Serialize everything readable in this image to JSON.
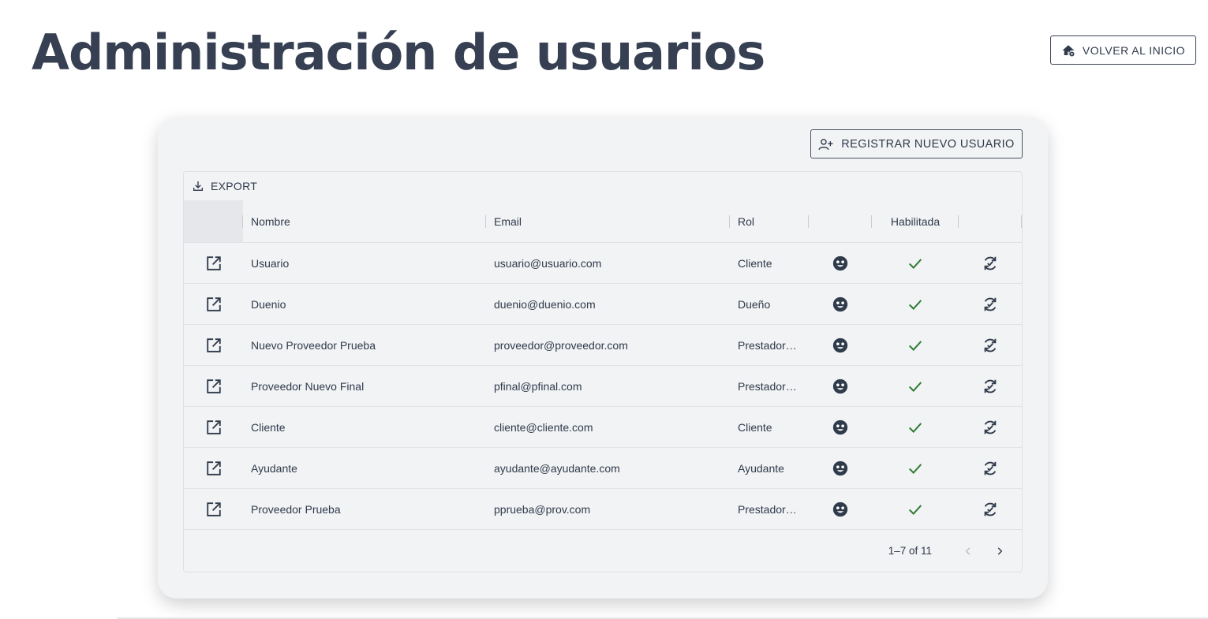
{
  "page": {
    "title": "Administración de usuarios",
    "home_button": "VOLVER AL INICIO"
  },
  "toolbar": {
    "register_button": "REGISTRAR NUEVO USUARIO",
    "export_button": "EXPORT"
  },
  "table": {
    "columns": [
      "Nombre",
      "Email",
      "Rol",
      "",
      "Habilitada",
      ""
    ],
    "rows": [
      {
        "nombre": "Usuario",
        "email": "usuario@usuario.com",
        "rol": "Cliente",
        "habilitada": true
      },
      {
        "nombre": "Duenio",
        "email": "duenio@duenio.com",
        "rol": "Dueño",
        "habilitada": true
      },
      {
        "nombre": "Nuevo Proveedor Prueba",
        "email": "proveedor@proveedor.com",
        "rol": "Prestador…",
        "habilitada": true
      },
      {
        "nombre": "Proveedor Nuevo Final",
        "email": "pfinal@pfinal.com",
        "rol": "Prestador…",
        "habilitada": true
      },
      {
        "nombre": "Cliente",
        "email": "cliente@cliente.com",
        "rol": "Cliente",
        "habilitada": true
      },
      {
        "nombre": "Ayudante",
        "email": "ayudante@ayudante.com",
        "rol": "Ayudante",
        "habilitada": true
      },
      {
        "nombre": "Proveedor Prueba",
        "email": "pprueba@prov.com",
        "rol": "Prestador…",
        "habilitada": true
      }
    ]
  },
  "pagination": {
    "label": "1–7 of 11",
    "prev_enabled": false,
    "next_enabled": true
  },
  "colors": {
    "title": "#364052",
    "check": "#2e7d32",
    "icon": "#2f3a4b",
    "disabled": "#b9bdc4"
  },
  "icons": {
    "home": "home-settings-icon",
    "register": "person-add-icon",
    "export": "download-icon",
    "open": "open-in-new-icon",
    "role": "face-icon",
    "enabled": "check-icon",
    "reset": "sync-icon",
    "prev": "chevron-left-icon",
    "next": "chevron-right-icon"
  }
}
